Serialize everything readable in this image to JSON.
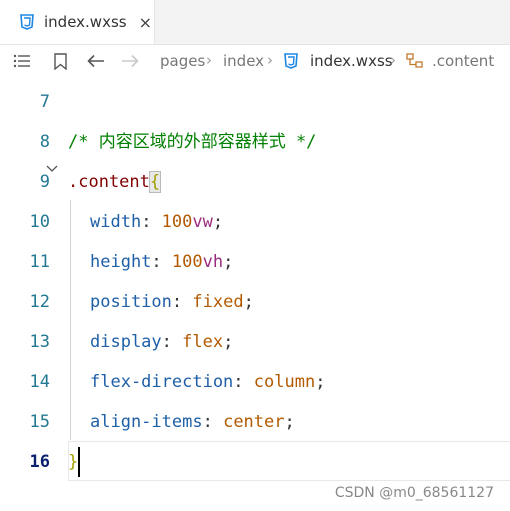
{
  "tab": {
    "filename": "index.wxss",
    "close": "×"
  },
  "breadcrumb": {
    "items": [
      "pages",
      "index",
      "index.wxss",
      ".content"
    ]
  },
  "icons": {
    "list": "list-icon",
    "bookmark": "bookmark-icon",
    "back": "arrow-left-icon",
    "forward": "arrow-right-icon",
    "css_file": "css-file-icon",
    "selector": "selector-icon"
  },
  "editor": {
    "line_numbers": [
      "7",
      "8",
      "9",
      "10",
      "11",
      "12",
      "13",
      "14",
      "15",
      "16"
    ],
    "comment": "/* 内容区域的外部容器样式 */",
    "selector": ".content",
    "open_brace": "{",
    "close_brace": "}",
    "declarations": [
      {
        "prop": "width",
        "value": "100",
        "unit": "vw"
      },
      {
        "prop": "height",
        "value": "100",
        "unit": "vh"
      },
      {
        "prop": "position",
        "value": "fixed",
        "unit": ""
      },
      {
        "prop": "display",
        "value": "flex",
        "unit": ""
      },
      {
        "prop": "flex-direction",
        "value": "column",
        "unit": ""
      },
      {
        "prop": "align-items",
        "value": "center",
        "unit": ""
      }
    ]
  },
  "watermark": "CSDN @m0_68561127",
  "colors": {
    "line_number": "#237893",
    "comment": "#008000",
    "property": "#1f5fa8",
    "value": "#b35a00",
    "css_icon": "#1e88e5"
  }
}
